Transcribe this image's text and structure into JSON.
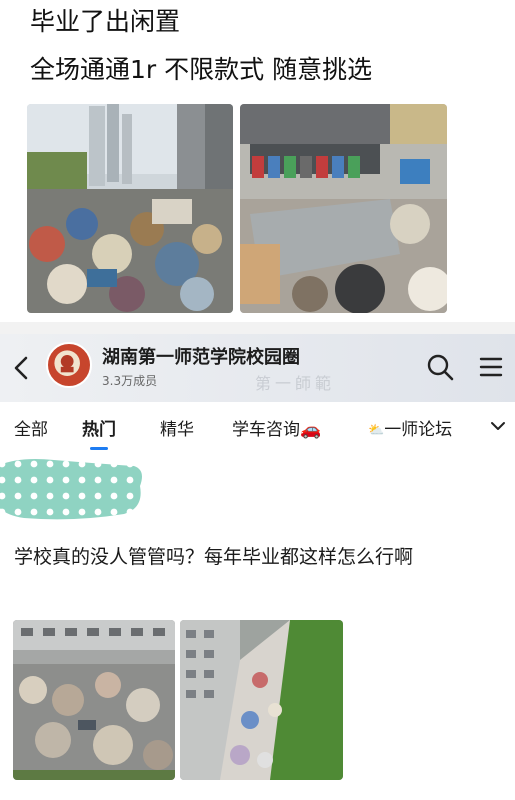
{
  "top_post": {
    "line1": "毕业了出闲置",
    "line2": "全场通通1r 不限款式 随意挑选",
    "photos": [
      {
        "icon": "trash-pile-photo"
      },
      {
        "icon": "trash-bins-photo"
      }
    ]
  },
  "group": {
    "name": "湖南第一师范学院校园圈",
    "members": "3.3万成员",
    "watermark": "第一師範",
    "back_icon": "chevron-left-icon",
    "search_icon": "search-icon",
    "menu_icon": "menu-icon"
  },
  "tabs": {
    "items": [
      "全部",
      "热门",
      "精华",
      "学车咨询",
      "一师论坛"
    ],
    "active": "热门",
    "car_emoji": "🚗",
    "weather_emoji": "⛅",
    "toggle_icon": "chevron-down-icon"
  },
  "post2": {
    "text": "学校真的没人管管吗？每年毕业都这样怎么行啊",
    "photos": [
      {
        "icon": "courtyard-trash-photo"
      },
      {
        "icon": "lawn-trash-photo"
      }
    ]
  },
  "colors": {
    "accent": "#1d7cf2",
    "dots": "#8fd3c2",
    "avatar_red": "#c7452d"
  }
}
